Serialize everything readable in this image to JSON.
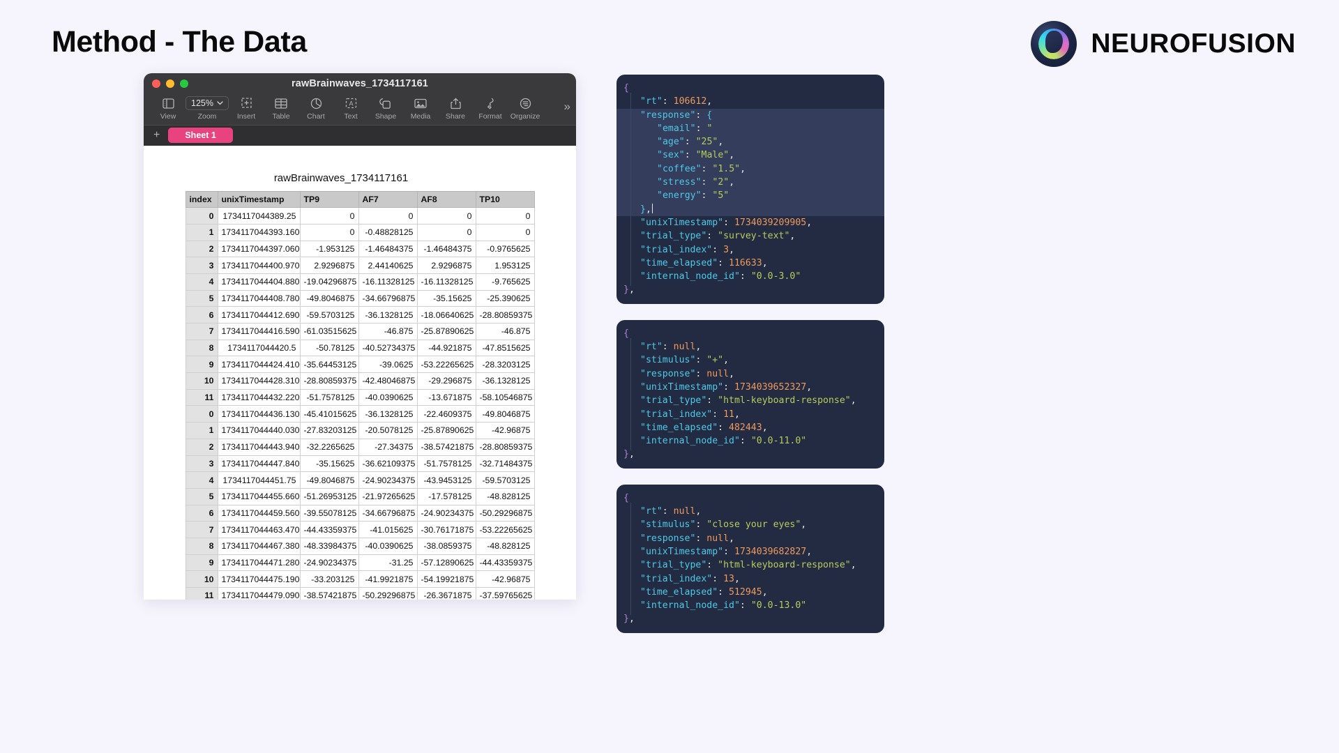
{
  "slide": {
    "title": "Method - The Data",
    "background": "#f6f5fd",
    "brand_name": "NEUROFUSION"
  },
  "spreadsheet": {
    "window_title": "rawBrainwaves_1734117161",
    "table_title": "rawBrainwaves_1734117161",
    "zoom_value": "125%",
    "sheet_tab": "Sheet 1",
    "add_sheet": "+",
    "overflow": "»",
    "sheet_tab_color": "#e8427f",
    "toolbar": [
      {
        "label": "View",
        "icon": "sidebar-icon"
      },
      {
        "label": "Zoom",
        "icon": "zoom-dropdown-icon"
      },
      {
        "label": "Insert",
        "icon": "insert-icon"
      },
      {
        "label": "Table",
        "icon": "table-icon"
      },
      {
        "label": "Chart",
        "icon": "chart-icon"
      },
      {
        "label": "Text",
        "icon": "text-icon"
      },
      {
        "label": "Shape",
        "icon": "shape-icon"
      },
      {
        "label": "Media",
        "icon": "media-icon"
      },
      {
        "label": "Share",
        "icon": "share-icon"
      },
      {
        "label": "Format",
        "icon": "format-brush-icon"
      },
      {
        "label": "Organize",
        "icon": "organize-icon"
      }
    ],
    "columns": [
      "index",
      "unixTimestamp",
      "TP9",
      "AF7",
      "AF8",
      "TP10"
    ],
    "rows": [
      [
        "0",
        "1734117044389.25",
        "0",
        "0",
        "0",
        "0"
      ],
      [
        "1",
        "1734117044393.1600",
        "0",
        "-0.48828125",
        "0",
        "0"
      ],
      [
        "2",
        "1734117044397.0600",
        "-1.953125",
        "-1.46484375",
        "-1.46484375",
        "-0.9765625"
      ],
      [
        "3",
        "1734117044400.9700",
        "2.9296875",
        "2.44140625",
        "2.9296875",
        "1.953125"
      ],
      [
        "4",
        "1734117044404.880",
        "-19.04296875",
        "-16.11328125",
        "-16.11328125",
        "-9.765625"
      ],
      [
        "5",
        "1734117044408.7800",
        "-49.8046875",
        "-34.66796875",
        "-35.15625",
        "-25.390625"
      ],
      [
        "6",
        "1734117044412.6900",
        "-59.5703125",
        "-36.1328125",
        "-18.06640625",
        "-28.80859375"
      ],
      [
        "7",
        "1734117044416.5900",
        "-61.03515625",
        "-46.875",
        "-25.87890625",
        "-46.875"
      ],
      [
        "8",
        "1734117044420.5",
        "-50.78125",
        "-40.52734375",
        "-44.921875",
        "-47.8515625"
      ],
      [
        "9",
        "1734117044424.4100",
        "-35.64453125",
        "-39.0625",
        "-53.22265625",
        "-28.3203125"
      ],
      [
        "10",
        "1734117044428.3100",
        "-28.80859375",
        "-42.48046875",
        "-29.296875",
        "-36.1328125"
      ],
      [
        "11",
        "1734117044432.2200",
        "-51.7578125",
        "-40.0390625",
        "-13.671875",
        "-58.10546875"
      ],
      [
        "0",
        "1734117044436.130",
        "-45.41015625",
        "-36.1328125",
        "-22.4609375",
        "-49.8046875"
      ],
      [
        "1",
        "1734117044440.0300",
        "-27.83203125",
        "-20.5078125",
        "-25.87890625",
        "-42.96875"
      ],
      [
        "2",
        "1734117044443.9400",
        "-32.2265625",
        "-27.34375",
        "-38.57421875",
        "-28.80859375"
      ],
      [
        "3",
        "1734117044447.8400",
        "-35.15625",
        "-36.62109375",
        "-51.7578125",
        "-32.71484375"
      ],
      [
        "4",
        "1734117044451.75",
        "-49.8046875",
        "-24.90234375",
        "-43.9453125",
        "-59.5703125"
      ],
      [
        "5",
        "1734117044455.6600",
        "-51.26953125",
        "-21.97265625",
        "-17.578125",
        "-48.828125"
      ],
      [
        "6",
        "1734117044459.5600",
        "-39.55078125",
        "-34.66796875",
        "-24.90234375",
        "-50.29296875"
      ],
      [
        "7",
        "1734117044463.4700",
        "-44.43359375",
        "-41.015625",
        "-30.76171875",
        "-53.22265625"
      ],
      [
        "8",
        "1734117044467.380",
        "-48.33984375",
        "-40.0390625",
        "-38.0859375",
        "-48.828125"
      ],
      [
        "9",
        "1734117044471.2800",
        "-24.90234375",
        "-31.25",
        "-57.12890625",
        "-44.43359375"
      ],
      [
        "10",
        "1734117044475.1900",
        "-33.203125",
        "-41.9921875",
        "-54.19921875",
        "-42.96875"
      ],
      [
        "11",
        "1734117044479.0900",
        "-38.57421875",
        "-50.29296875",
        "-26.3671875",
        "-37.59765625"
      ]
    ]
  },
  "json_cards": [
    {
      "id": "trial-survey-text",
      "lines": [
        {
          "indent": 0,
          "tokens": [
            {
              "t": "{",
              "c": "p"
            }
          ]
        },
        {
          "indent": 1,
          "sel": false,
          "tokens": [
            {
              "t": "\"rt\"",
              "c": "k"
            },
            {
              "t": ": ",
              "c": "pn"
            },
            {
              "t": "106612",
              "c": "n"
            },
            {
              "t": ",",
              "c": "pn"
            }
          ]
        },
        {
          "indent": 1,
          "sel": true,
          "tokens": [
            {
              "t": "\"response\"",
              "c": "k"
            },
            {
              "t": ": ",
              "c": "pn"
            },
            {
              "t": "{",
              "c": "k"
            }
          ]
        },
        {
          "indent": 2,
          "sel": true,
          "tokens": [
            {
              "t": "\"email\"",
              "c": "k"
            },
            {
              "t": ": ",
              "c": "pn"
            },
            {
              "t": "\"",
              "c": "s"
            }
          ]
        },
        {
          "indent": 2,
          "sel": true,
          "tokens": [
            {
              "t": "\"age\"",
              "c": "k"
            },
            {
              "t": ": ",
              "c": "pn"
            },
            {
              "t": "\"25\"",
              "c": "s"
            },
            {
              "t": ",",
              "c": "pn"
            }
          ]
        },
        {
          "indent": 2,
          "sel": true,
          "tokens": [
            {
              "t": "\"sex\"",
              "c": "k"
            },
            {
              "t": ": ",
              "c": "pn"
            },
            {
              "t": "\"Male\"",
              "c": "s"
            },
            {
              "t": ",",
              "c": "pn"
            }
          ]
        },
        {
          "indent": 2,
          "sel": true,
          "tokens": [
            {
              "t": "\"coffee\"",
              "c": "k"
            },
            {
              "t": ": ",
              "c": "pn"
            },
            {
              "t": "\"1.5\"",
              "c": "s"
            },
            {
              "t": ",",
              "c": "pn"
            }
          ]
        },
        {
          "indent": 2,
          "sel": true,
          "tokens": [
            {
              "t": "\"stress\"",
              "c": "k"
            },
            {
              "t": ": ",
              "c": "pn"
            },
            {
              "t": "\"2\"",
              "c": "s"
            },
            {
              "t": ",",
              "c": "pn"
            }
          ]
        },
        {
          "indent": 2,
          "sel": true,
          "tokens": [
            {
              "t": "\"energy\"",
              "c": "k"
            },
            {
              "t": ": ",
              "c": "pn"
            },
            {
              "t": "\"5\"",
              "c": "s"
            }
          ]
        },
        {
          "indent": 1,
          "sel": true,
          "caret": true,
          "tokens": [
            {
              "t": "}",
              "c": "k"
            },
            {
              "t": ",",
              "c": "pn"
            }
          ]
        },
        {
          "indent": 1,
          "tokens": [
            {
              "t": "\"unixTimestamp\"",
              "c": "k"
            },
            {
              "t": ": ",
              "c": "pn"
            },
            {
              "t": "1734039209905",
              "c": "n"
            },
            {
              "t": ",",
              "c": "pn"
            }
          ]
        },
        {
          "indent": 1,
          "tokens": [
            {
              "t": "\"trial_type\"",
              "c": "k"
            },
            {
              "t": ": ",
              "c": "pn"
            },
            {
              "t": "\"survey-text\"",
              "c": "s"
            },
            {
              "t": ",",
              "c": "pn"
            }
          ]
        },
        {
          "indent": 1,
          "tokens": [
            {
              "t": "\"trial_index\"",
              "c": "k"
            },
            {
              "t": ": ",
              "c": "pn"
            },
            {
              "t": "3",
              "c": "n"
            },
            {
              "t": ",",
              "c": "pn"
            }
          ]
        },
        {
          "indent": 1,
          "tokens": [
            {
              "t": "\"time_elapsed\"",
              "c": "k"
            },
            {
              "t": ": ",
              "c": "pn"
            },
            {
              "t": "116633",
              "c": "n"
            },
            {
              "t": ",",
              "c": "pn"
            }
          ]
        },
        {
          "indent": 1,
          "tokens": [
            {
              "t": "\"internal_node_id\"",
              "c": "k"
            },
            {
              "t": ": ",
              "c": "pn"
            },
            {
              "t": "\"0.0-3.0\"",
              "c": "s"
            }
          ]
        },
        {
          "indent": 0,
          "tokens": [
            {
              "t": "}",
              "c": "p"
            },
            {
              "t": ",",
              "c": "pn"
            }
          ]
        }
      ]
    },
    {
      "id": "trial-fixation",
      "lines": [
        {
          "indent": 0,
          "tokens": [
            {
              "t": "{",
              "c": "p"
            }
          ]
        },
        {
          "indent": 1,
          "tokens": [
            {
              "t": "\"rt\"",
              "c": "k"
            },
            {
              "t": ": ",
              "c": "pn"
            },
            {
              "t": "null",
              "c": "n"
            },
            {
              "t": ",",
              "c": "pn"
            }
          ]
        },
        {
          "indent": 1,
          "tokens": [
            {
              "t": "\"stimulus\"",
              "c": "k"
            },
            {
              "t": ": ",
              "c": "pn"
            },
            {
              "t": "\"+\"",
              "c": "s"
            },
            {
              "t": ",",
              "c": "pn"
            }
          ]
        },
        {
          "indent": 1,
          "tokens": [
            {
              "t": "\"response\"",
              "c": "k"
            },
            {
              "t": ": ",
              "c": "pn"
            },
            {
              "t": "null",
              "c": "n"
            },
            {
              "t": ",",
              "c": "pn"
            }
          ]
        },
        {
          "indent": 1,
          "tokens": [
            {
              "t": "\"unixTimestamp\"",
              "c": "k"
            },
            {
              "t": ": ",
              "c": "pn"
            },
            {
              "t": "1734039652327",
              "c": "n"
            },
            {
              "t": ",",
              "c": "pn"
            }
          ]
        },
        {
          "indent": 1,
          "tokens": [
            {
              "t": "\"trial_type\"",
              "c": "k"
            },
            {
              "t": ": ",
              "c": "pn"
            },
            {
              "t": "\"html-keyboard-response\"",
              "c": "s"
            },
            {
              "t": ",",
              "c": "pn"
            }
          ]
        },
        {
          "indent": 1,
          "tokens": [
            {
              "t": "\"trial_index\"",
              "c": "k"
            },
            {
              "t": ": ",
              "c": "pn"
            },
            {
              "t": "11",
              "c": "n"
            },
            {
              "t": ",",
              "c": "pn"
            }
          ]
        },
        {
          "indent": 1,
          "tokens": [
            {
              "t": "\"time_elapsed\"",
              "c": "k"
            },
            {
              "t": ": ",
              "c": "pn"
            },
            {
              "t": "482443",
              "c": "n"
            },
            {
              "t": ",",
              "c": "pn"
            }
          ]
        },
        {
          "indent": 1,
          "tokens": [
            {
              "t": "\"internal_node_id\"",
              "c": "k"
            },
            {
              "t": ": ",
              "c": "pn"
            },
            {
              "t": "\"0.0-11.0\"",
              "c": "s"
            }
          ]
        },
        {
          "indent": 0,
          "tokens": [
            {
              "t": "}",
              "c": "p"
            },
            {
              "t": ",",
              "c": "pn"
            }
          ]
        }
      ]
    },
    {
      "id": "trial-close-your-eyes",
      "lines": [
        {
          "indent": 0,
          "tokens": [
            {
              "t": "{",
              "c": "p"
            }
          ]
        },
        {
          "indent": 1,
          "tokens": [
            {
              "t": "\"rt\"",
              "c": "k"
            },
            {
              "t": ": ",
              "c": "pn"
            },
            {
              "t": "null",
              "c": "n"
            },
            {
              "t": ",",
              "c": "pn"
            }
          ]
        },
        {
          "indent": 1,
          "tokens": [
            {
              "t": "\"stimulus\"",
              "c": "k"
            },
            {
              "t": ": ",
              "c": "pn"
            },
            {
              "t": "\"close your eyes\"",
              "c": "s"
            },
            {
              "t": ",",
              "c": "pn"
            }
          ]
        },
        {
          "indent": 1,
          "tokens": [
            {
              "t": "\"response\"",
              "c": "k"
            },
            {
              "t": ": ",
              "c": "pn"
            },
            {
              "t": "null",
              "c": "n"
            },
            {
              "t": ",",
              "c": "pn"
            }
          ]
        },
        {
          "indent": 1,
          "tokens": [
            {
              "t": "\"unixTimestamp\"",
              "c": "k"
            },
            {
              "t": ": ",
              "c": "pn"
            },
            {
              "t": "1734039682827",
              "c": "n"
            },
            {
              "t": ",",
              "c": "pn"
            }
          ]
        },
        {
          "indent": 1,
          "tokens": [
            {
              "t": "\"trial_type\"",
              "c": "k"
            },
            {
              "t": ": ",
              "c": "pn"
            },
            {
              "t": "\"html-keyboard-response\"",
              "c": "s"
            },
            {
              "t": ",",
              "c": "pn"
            }
          ]
        },
        {
          "indent": 1,
          "tokens": [
            {
              "t": "\"trial_index\"",
              "c": "k"
            },
            {
              "t": ": ",
              "c": "pn"
            },
            {
              "t": "13",
              "c": "n"
            },
            {
              "t": ",",
              "c": "pn"
            }
          ]
        },
        {
          "indent": 1,
          "tokens": [
            {
              "t": "\"time_elapsed\"",
              "c": "k"
            },
            {
              "t": ": ",
              "c": "pn"
            },
            {
              "t": "512945",
              "c": "n"
            },
            {
              "t": ",",
              "c": "pn"
            }
          ]
        },
        {
          "indent": 1,
          "tokens": [
            {
              "t": "\"internal_node_id\"",
              "c": "k"
            },
            {
              "t": ": ",
              "c": "pn"
            },
            {
              "t": "\"0.0-13.0\"",
              "c": "s"
            }
          ]
        },
        {
          "indent": 0,
          "tokens": [
            {
              "t": "}",
              "c": "p"
            },
            {
              "t": ",",
              "c": "pn"
            }
          ]
        }
      ]
    }
  ]
}
